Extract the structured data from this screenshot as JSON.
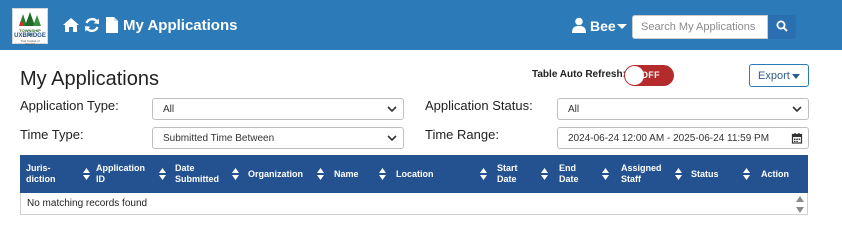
{
  "logo": {
    "line1": "TOWNSHIP OF",
    "line2": "UXBRIDGE",
    "line3": "Trail Capital of Canada"
  },
  "nav": {
    "title": "My Applications",
    "user": "Bee"
  },
  "search": {
    "placeholder": "Search My Applications"
  },
  "page": {
    "title": "My Applications",
    "auto_refresh_label": "Table Auto Refresh:",
    "auto_refresh_state": "OFF",
    "export_label": "Export"
  },
  "filters": {
    "application_type": {
      "label": "Application Type:",
      "value": "All"
    },
    "application_status": {
      "label": "Application Status:",
      "value": "All"
    },
    "time_type": {
      "label": "Time Type:",
      "value": "Submitted Time Between"
    },
    "time_range": {
      "label": "Time Range:",
      "value": "2024-06-24 12:00 AM - 2025-06-24 11:59 PM"
    }
  },
  "table": {
    "columns": [
      "Juris-\ndiction",
      "Application\nID",
      "Date\nSubmitted",
      "Organization",
      "Name",
      "Location",
      "Start\nDate",
      "End\nDate",
      "Assigned\nStaff",
      "Status",
      "Action"
    ],
    "empty_message": "No matching records found"
  },
  "colors": {
    "navbar": "#2c7bb8",
    "table_header": "#24518f",
    "toggle_off": "#b52a2a"
  },
  "icons": [
    "home-icon",
    "refresh-icon",
    "file-icon",
    "user-icon",
    "search-icon",
    "calendar-icon"
  ]
}
